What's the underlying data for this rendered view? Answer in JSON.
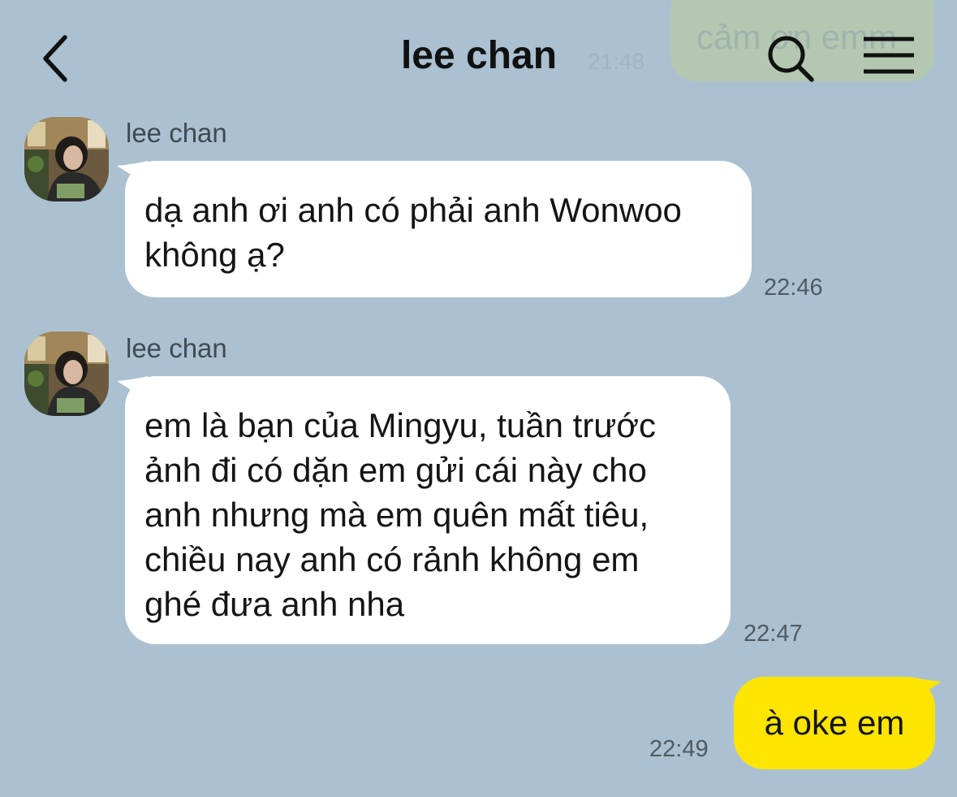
{
  "header": {
    "title": "lee chan"
  },
  "background_bubble": {
    "text": "cảm ơn emm",
    "time": "21:48"
  },
  "messages": [
    {
      "sender": "lee chan",
      "lines": [
        "dạ anh ơi anh có phải anh Wonwoo",
        "không ạ?"
      ],
      "time": "22:46"
    },
    {
      "sender": "lee chan",
      "lines": [
        "em là bạn của Mingyu, tuần trước",
        "ảnh đi có dặn em gửi cái này cho",
        "anh nhưng mà em quên mất tiêu,",
        "chiều nay anh có rảnh không em",
        "ghé đưa anh nha"
      ],
      "time": "22:47"
    },
    {
      "sender": "me",
      "text": "à oke em",
      "time": "22:49"
    }
  ],
  "icons": {
    "back": "chevron-left-icon",
    "search": "search-icon",
    "menu": "hamburger-menu-icon"
  },
  "colors": {
    "background": "#abc1d1",
    "incoming_bubble": "#ffffff",
    "outgoing_bubble": "#fee500"
  }
}
